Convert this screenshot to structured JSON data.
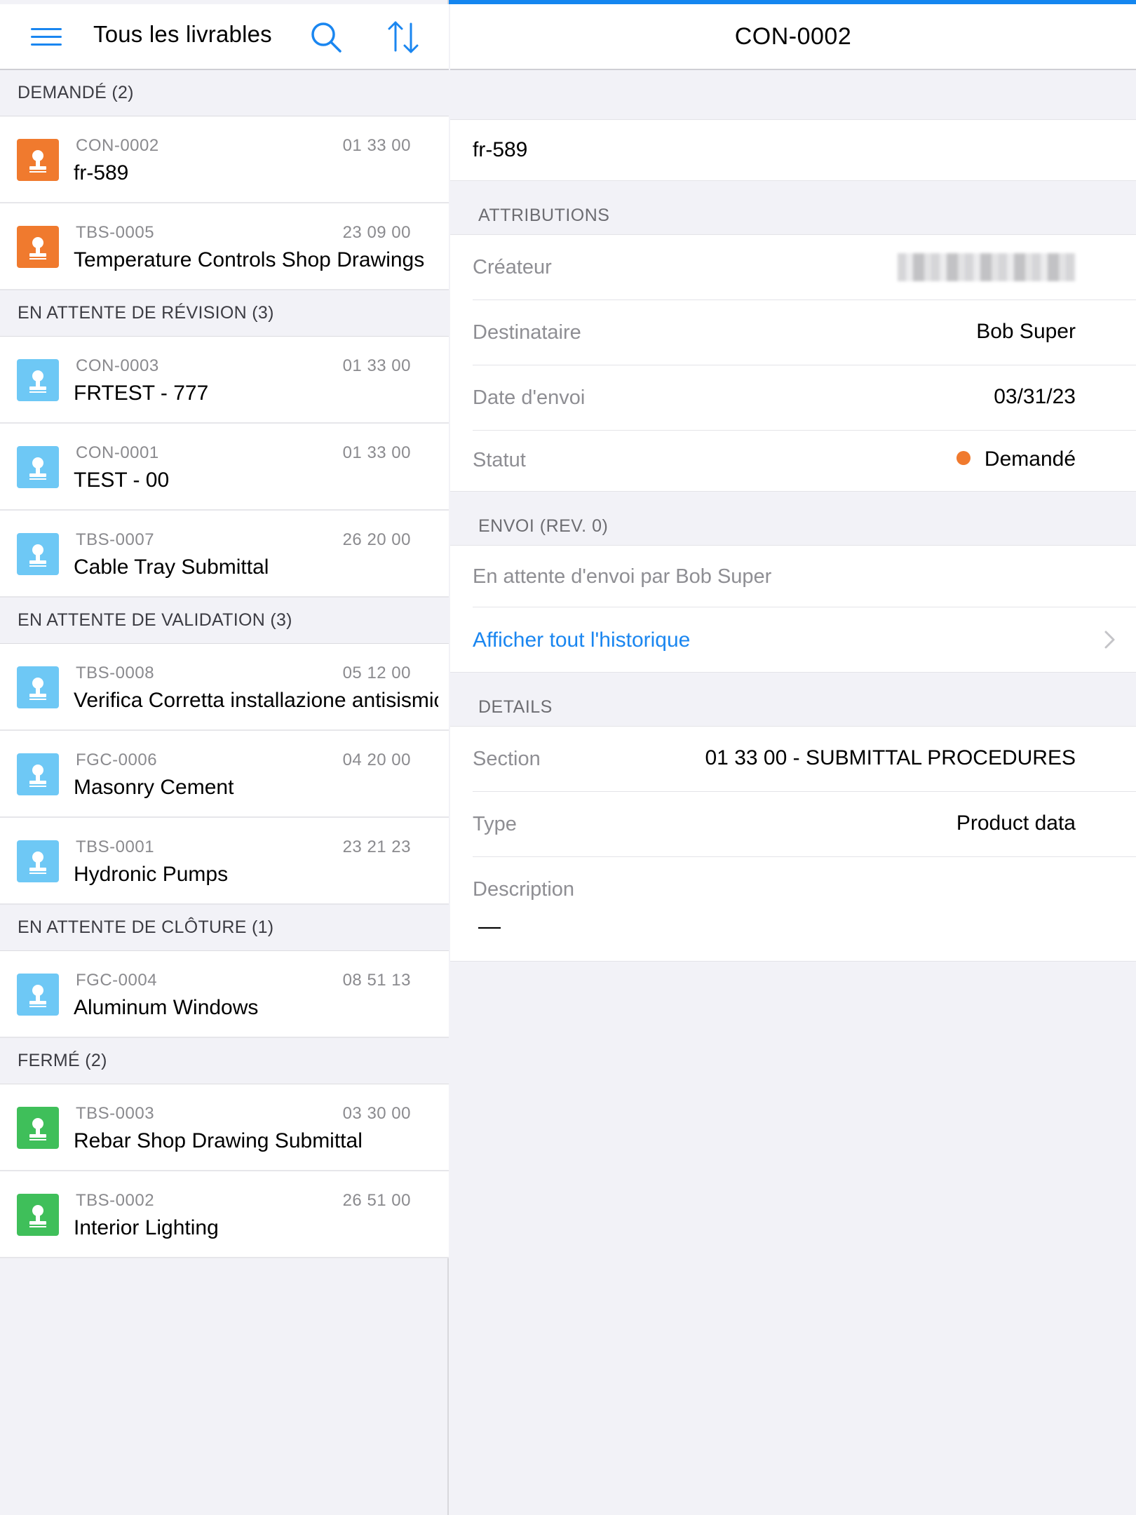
{
  "left_header": {
    "title": "Tous les livrables"
  },
  "sections": [
    {
      "label": "DEMANDÉ (2)",
      "items": [
        {
          "code": "CON-0002",
          "number": "01 33 00",
          "title": "fr-589",
          "icon_color": "#f07a2e"
        },
        {
          "code": "TBS-0005",
          "number": "23 09 00",
          "title": "Temperature Controls Shop Drawings",
          "icon_color": "#f07a2e"
        }
      ]
    },
    {
      "label": "EN ATTENTE DE RÉVISION (3)",
      "items": [
        {
          "code": "CON-0003",
          "number": "01 33 00",
          "title": "FRTEST - 777",
          "icon_color": "#6ec8f5"
        },
        {
          "code": "CON-0001",
          "number": "01 33 00",
          "title": "TEST - 00",
          "icon_color": "#6ec8f5"
        },
        {
          "code": "TBS-0007",
          "number": "26 20 00",
          "title": "Cable Tray Submittal",
          "icon_color": "#6ec8f5"
        }
      ]
    },
    {
      "label": "EN ATTENTE DE VALIDATION (3)",
      "items": [
        {
          "code": "TBS-0008",
          "number": "05 12 00",
          "title": "Verifica Corretta installazione antisismica",
          "icon_color": "#6ec8f5"
        },
        {
          "code": "FGC-0006",
          "number": "04 20 00",
          "title": "Masonry Cement",
          "icon_color": "#6ec8f5"
        },
        {
          "code": "TBS-0001",
          "number": "23 21 23",
          "title": "Hydronic Pumps",
          "icon_color": "#6ec8f5"
        }
      ]
    },
    {
      "label": "EN ATTENTE DE CLÔTURE (1)",
      "items": [
        {
          "code": "FGC-0004",
          "number": "08 51 13",
          "title": "Aluminum Windows",
          "icon_color": "#6ec8f5"
        }
      ]
    },
    {
      "label": "FERMÉ (2)",
      "items": [
        {
          "code": "TBS-0003",
          "number": "03 30 00",
          "title": "Rebar Shop Drawing Submittal",
          "icon_color": "#3fbf5a"
        },
        {
          "code": "TBS-0002",
          "number": "26 51 00",
          "title": "Interior Lighting",
          "icon_color": "#3fbf5a"
        }
      ]
    }
  ],
  "detail": {
    "header_title": "CON-0002",
    "name": "fr-589",
    "attributions": {
      "section_label": "ATTRIBUTIONS",
      "creator_label": "Créateur",
      "recipient_label": "Destinataire",
      "recipient_value": "Bob Super",
      "date_label": "Date d'envoi",
      "date_value": "03/31/23",
      "status_label": "Statut",
      "status_value": "Demandé",
      "status_color": "#f07a2e"
    },
    "envoi": {
      "section_label": "ENVOI (REV. 0)",
      "waiting_text": "En attente d'envoi par Bob Super",
      "history_link": "Afficher tout l'historique"
    },
    "details": {
      "section_label": "DETAILS",
      "section_key": "Section",
      "section_value": "01 33 00 - SUBMITTAL PROCEDURES",
      "type_key": "Type",
      "type_value": "Product data",
      "description_key": "Description",
      "description_value": "—"
    }
  },
  "colors": {
    "accent": "#1a86f0",
    "requested": "#f07a2e",
    "in_progress": "#6ec8f5",
    "closed": "#3fbf5a"
  },
  "progress": 1.0
}
